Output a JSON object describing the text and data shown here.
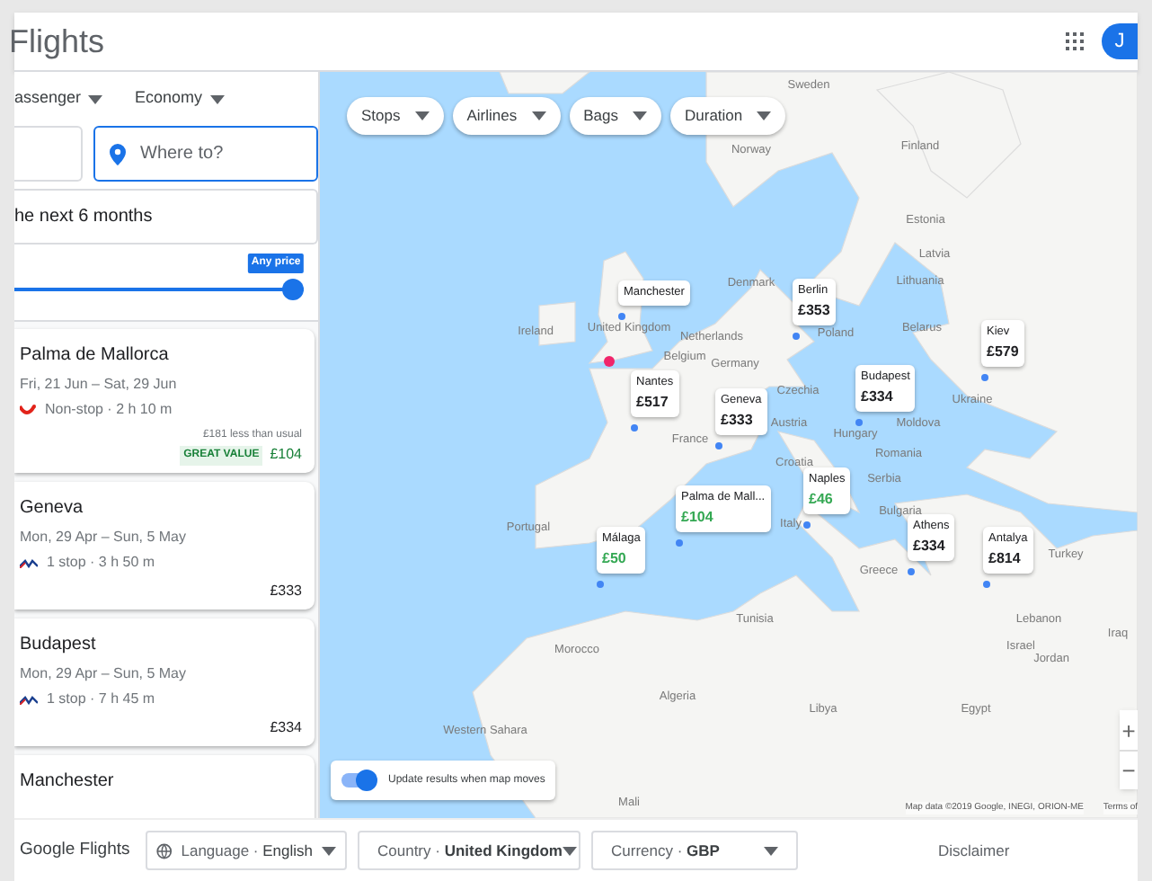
{
  "header": {
    "title": "Flights",
    "avatar": "J"
  },
  "search": {
    "passengers": "assenger",
    "cabin": "Economy",
    "destination_placeholder": "Where to?",
    "dates": "he next 6 months",
    "price_slider": {
      "tooltip": "Any price",
      "level": 1
    }
  },
  "results": [
    {
      "city": "Palma de Mallorca",
      "dates": "Fri, 21 Jun – Sat, 29 Jun",
      "stops": "Non-stop · 2 h 10 m",
      "kind": "red",
      "note": "£181 less than usual",
      "badge": "GREAT VALUE",
      "price": "£104",
      "highlight": true
    },
    {
      "city": "Geneva",
      "dates": "Mon, 29 Apr – Sun, 5 May",
      "stops": "1 stop · 3 h 50 m",
      "kind": "stripes",
      "price": "£333",
      "highlight": false
    },
    {
      "city": "Budapest",
      "dates": "Mon, 29 Apr – Sun, 5 May",
      "stops": "1 stop · 7 h 45 m",
      "kind": "stripes",
      "price": "£334",
      "highlight": false
    },
    {
      "city": "Manchester"
    }
  ],
  "filters": [
    "Stops",
    "Airlines",
    "Bags",
    "Duration"
  ],
  "map_labels": [
    "Sweden",
    "Norway",
    "Finland",
    "Estonia",
    "Latvia",
    "Lithuania",
    "Denmark",
    "Ireland",
    "United Kingdom",
    "Netherlands",
    "Germany",
    "Belgium",
    "Poland",
    "Belarus",
    "Czechia",
    "Austria",
    "Ukraine",
    "Moldova",
    "Hungary",
    "France",
    "Romania",
    "Croatia",
    "Serbia",
    "Italy",
    "Bulgaria",
    "Portugal",
    "Greece",
    "Turkey",
    "Tunisia",
    "Lebanon",
    "Israel",
    "Jordan",
    "Iraq",
    "Morocco",
    "Algeria",
    "Libya",
    "Egypt",
    "Western Sahara",
    "Mali"
  ],
  "pins": [
    {
      "city": "Manchester"
    },
    {
      "city": "Berlin",
      "price": "£353",
      "highlight": false
    },
    {
      "city": "Kiev",
      "price": "£579",
      "highlight": false
    },
    {
      "city": "Nantes",
      "price": "£517",
      "highlight": false
    },
    {
      "city": "Geneva",
      "price": "£333",
      "highlight": false
    },
    {
      "city": "Budapest",
      "price": "£334",
      "highlight": false
    },
    {
      "city": "Naples",
      "price": "£46",
      "highlight": true
    },
    {
      "city": "Palma de Mall...",
      "price": "£104",
      "highlight": true
    },
    {
      "city": "Athens",
      "price": "£334",
      "highlight": false
    },
    {
      "city": "Málaga",
      "price": "£50",
      "highlight": true
    },
    {
      "city": "Antalya",
      "price": "£814",
      "highlight": false
    }
  ],
  "map_toggle": {
    "label": "Update results when map moves",
    "on": true
  },
  "zoom": {
    "in": "+",
    "out": "−"
  },
  "attribution": "Map data ©2019 Google, INEGI, ORION-ME",
  "terms": "Terms of",
  "footer": {
    "brand": "Google Flights",
    "language_label": "Language · ",
    "language": "English",
    "country_label": "Country · ",
    "country": "United Kingdom",
    "currency_label": "Currency · ",
    "currency": "GBP",
    "disclaimer": "Disclaimer"
  }
}
